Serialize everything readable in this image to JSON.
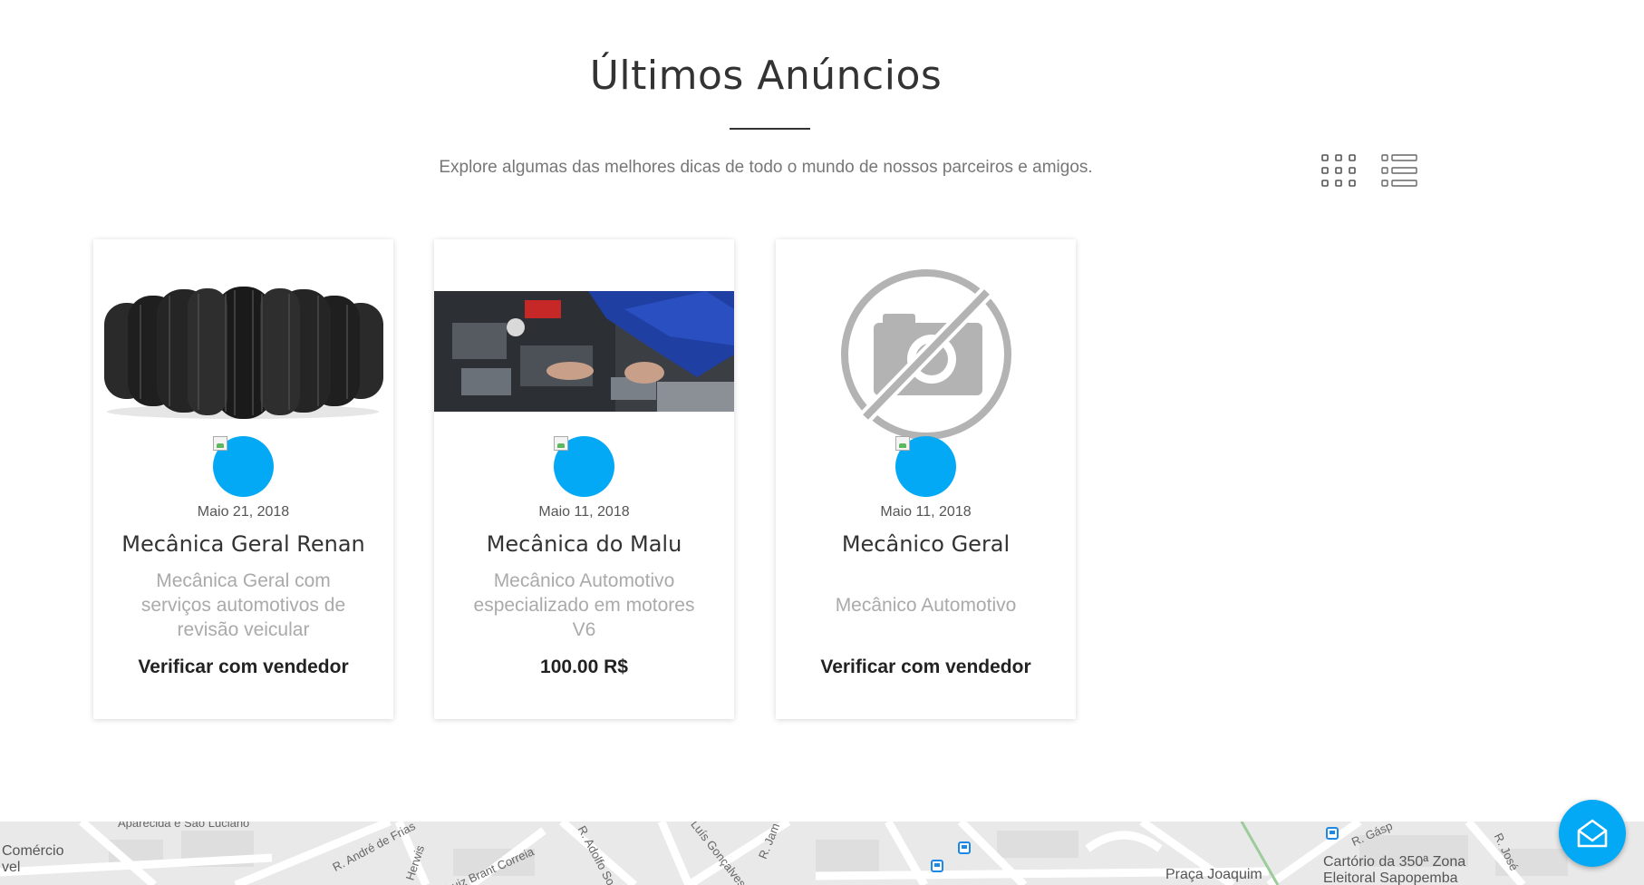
{
  "section": {
    "title": "Últimos Anúncios",
    "subtitle": "Explore algumas das melhores dicas de todo o mundo de nossos parceiros e amigos."
  },
  "view_toggles": [
    {
      "name": "grid-view-icon"
    },
    {
      "name": "list-view-icon"
    }
  ],
  "listings": [
    {
      "image": "tires-photo",
      "date": "Maio 21, 2018",
      "title": "Mecânica Geral Renan",
      "description": "Mecânica Geral com serviços automotivos de revisão veicular",
      "price": "Verificar com vendedor"
    },
    {
      "image": "mechanic-engine-photo",
      "date": "Maio 11, 2018",
      "title": "Mecânica do Malu",
      "description": "Mecânico Automotivo especializado em motores V6",
      "price": "100.00 R$"
    },
    {
      "image": "no-photo-icon",
      "date": "Maio 11, 2018",
      "title": "Mecânico Geral",
      "description": "Mecânico Automotivo",
      "price": "Verificar com vendedor"
    }
  ],
  "map": {
    "labels": {
      "comercio": "Comércio",
      "vel": "vel",
      "aparecida": "Aparecida e São Luciano",
      "andre": "R. André de Frias",
      "herwis": "Herwis",
      "brant": "Luiz Brant Correia",
      "adolfo": "R. Adolfo So",
      "luis": "Luís Gonçalves",
      "jam": "R. Jam",
      "praca": "Praça Joaquim",
      "cartorio1": "Cartório da 350ª Zona",
      "cartorio2": "Eleitoral Sapopemba",
      "gasp": "R. Gásp",
      "jose": "R. José"
    }
  },
  "chat": {
    "icon": "envelope-icon"
  },
  "colors": {
    "accent": "#03a9f4",
    "title": "#333333",
    "muted": "#aaaaaa"
  }
}
